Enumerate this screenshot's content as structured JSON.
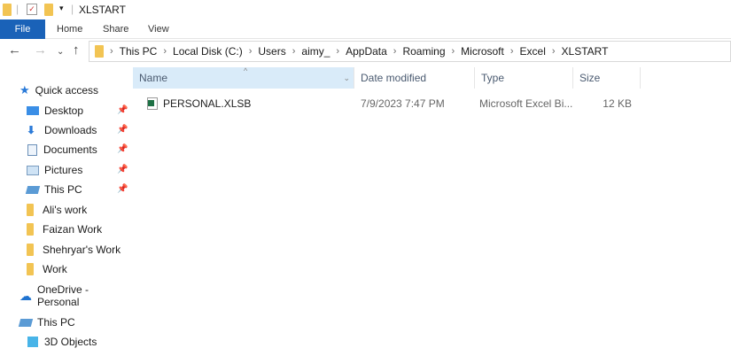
{
  "window": {
    "title": "XLSTART"
  },
  "ribbon": {
    "tabs": [
      "File",
      "Home",
      "Share",
      "View"
    ]
  },
  "address": {
    "crumbs": [
      "This PC",
      "Local Disk (C:)",
      "Users",
      "aimy_",
      "AppData",
      "Roaming",
      "Microsoft",
      "Excel",
      "XLSTART"
    ]
  },
  "sidebar": {
    "items": [
      {
        "label": "Quick access",
        "icon": "star-icon"
      },
      {
        "label": "Desktop",
        "icon": "desktop-icon",
        "pinned": true
      },
      {
        "label": "Downloads",
        "icon": "download-icon",
        "pinned": true
      },
      {
        "label": "Documents",
        "icon": "documents-icon",
        "pinned": true
      },
      {
        "label": "Pictures",
        "icon": "pictures-icon",
        "pinned": true
      },
      {
        "label": "This PC",
        "icon": "computer-icon",
        "pinned": true
      },
      {
        "label": "Ali's work",
        "icon": "folder-icon"
      },
      {
        "label": "Faizan Work",
        "icon": "folder-icon"
      },
      {
        "label": "Shehryar's Work",
        "icon": "folder-icon"
      },
      {
        "label": "Work",
        "icon": "folder-icon"
      },
      {
        "label": "OneDrive - Personal",
        "icon": "cloud-icon"
      },
      {
        "label": "This PC",
        "icon": "computer-icon"
      },
      {
        "label": "3D Objects",
        "icon": "cube-icon"
      }
    ]
  },
  "columns": {
    "name": "Name",
    "date": "Date modified",
    "type": "Type",
    "size": "Size"
  },
  "files": [
    {
      "name": "PERSONAL.XLSB",
      "date": "7/9/2023 7:47 PM",
      "type": "Microsoft Excel Bi...",
      "size": "12 KB"
    }
  ]
}
